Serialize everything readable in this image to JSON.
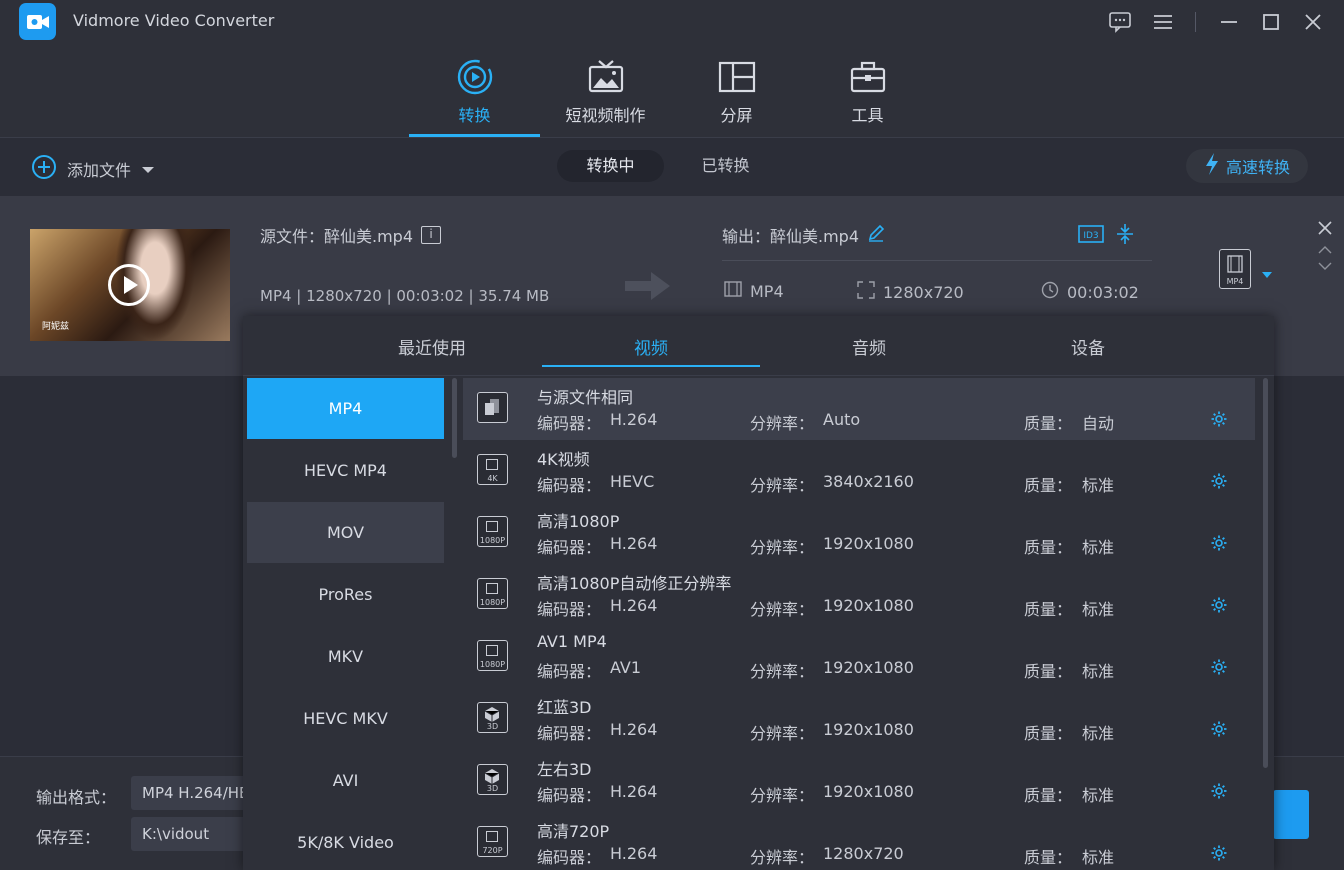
{
  "app": {
    "title": "Vidmore Video Converter"
  },
  "nav": {
    "tabs": [
      {
        "label": "转换",
        "icon": "convert-icon",
        "active": true
      },
      {
        "label": "短视频制作",
        "icon": "mv-icon",
        "active": false
      },
      {
        "label": "分屏",
        "icon": "collage-icon",
        "active": false
      },
      {
        "label": "工具",
        "icon": "toolbox-icon",
        "active": false
      }
    ]
  },
  "toolbar": {
    "add_file": "添加文件",
    "converting": "转换中",
    "converted": "已转换",
    "fast_convert": "高速转换"
  },
  "file": {
    "source_name": "源文件：醉仙美.mp4",
    "source_meta": "MP4 | 1280x720 | 00:03:02 | 35.74 MB",
    "output_name": "输出：醉仙美.mp4",
    "out_format": "MP4",
    "out_resolution": "1280x720",
    "out_duration": "00:03:02",
    "badge": "MP4",
    "thumb_watermark": "阿妮兹"
  },
  "popup": {
    "tabs": [
      "最近使用",
      "视频",
      "音频",
      "设备"
    ],
    "active_tab": "视频",
    "formats": [
      "MP4",
      "HEVC MP4",
      "MOV",
      "ProRes",
      "MKV",
      "HEVC MKV",
      "AVI",
      "5K/8K Video"
    ],
    "selected_format": "MP4",
    "labels": {
      "encoder": "编码器：",
      "resolution": "分辨率：",
      "quality": "质量："
    },
    "presets": [
      {
        "name": "与源文件相同",
        "encoder": "H.264",
        "resolution": "Auto",
        "quality": "自动",
        "tag": ""
      },
      {
        "name": "4K视频",
        "encoder": "HEVC",
        "resolution": "3840x2160",
        "quality": "标准",
        "tag": "4K"
      },
      {
        "name": "高清1080P",
        "encoder": "H.264",
        "resolution": "1920x1080",
        "quality": "标准",
        "tag": "1080P"
      },
      {
        "name": "高清1080P自动修正分辨率",
        "encoder": "H.264",
        "resolution": "1920x1080",
        "quality": "标准",
        "tag": "1080P"
      },
      {
        "name": "AV1 MP4",
        "encoder": "AV1",
        "resolution": "1920x1080",
        "quality": "标准",
        "tag": "1080P"
      },
      {
        "name": "红蓝3D",
        "encoder": "H.264",
        "resolution": "1920x1080",
        "quality": "标准",
        "tag": "3D"
      },
      {
        "name": "左右3D",
        "encoder": "H.264",
        "resolution": "1920x1080",
        "quality": "标准",
        "tag": "3D"
      },
      {
        "name": "高清720P",
        "encoder": "H.264",
        "resolution": "1280x720",
        "quality": "标准",
        "tag": "720P"
      }
    ]
  },
  "bottom": {
    "format_label": "输出格式：",
    "format_value": "MP4 H.264/HE",
    "save_label": "保存至：",
    "save_value": "K:\\vidout"
  },
  "colors": {
    "accent": "#2ab0f5",
    "selected": "#1ea7f5",
    "background": "#2b2d37"
  }
}
